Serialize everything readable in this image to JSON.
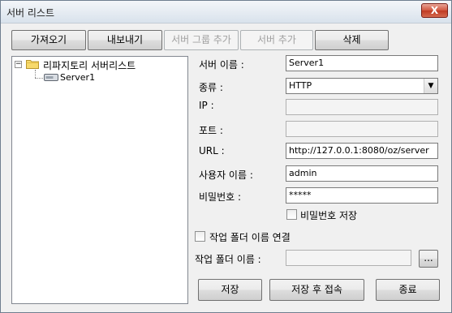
{
  "window": {
    "title": "서버 리스트",
    "close_symbol": "X"
  },
  "toolbar": {
    "import_label": "가져오기",
    "export_label": "내보내기",
    "add_group_label": "서버 그룹 추가",
    "add_server_label": "서버 추가",
    "delete_label": "삭제"
  },
  "tree": {
    "expander_symbol": "−",
    "root_label": "리파지토리 서버리스트",
    "children": [
      {
        "label": "Server1"
      }
    ]
  },
  "form": {
    "server_name": {
      "label": "서버 이름 :",
      "value": "Server1"
    },
    "type": {
      "label": "종류 :",
      "value": "HTTP",
      "arrow": "▼"
    },
    "ip": {
      "label": "IP :",
      "value": ""
    },
    "port": {
      "label": "포트 :",
      "value": ""
    },
    "url": {
      "label": "URL :",
      "value": "http://127.0.0.1:8080/oz/server"
    },
    "username": {
      "label": "사용자 이름 :",
      "value": "admin"
    },
    "password": {
      "label": "비밀번호 :",
      "value": "*****"
    },
    "save_password": {
      "label": "비밀번호 저장",
      "checked": false
    },
    "link_folder": {
      "label": "작업 폴더 이름 연결",
      "checked": false
    },
    "work_folder": {
      "label": "작업 폴더 이름 :",
      "value": "",
      "browse_label": "..."
    }
  },
  "footer": {
    "save_label": "저장",
    "save_connect_label": "저장 후 접속",
    "close_label": "종료"
  }
}
